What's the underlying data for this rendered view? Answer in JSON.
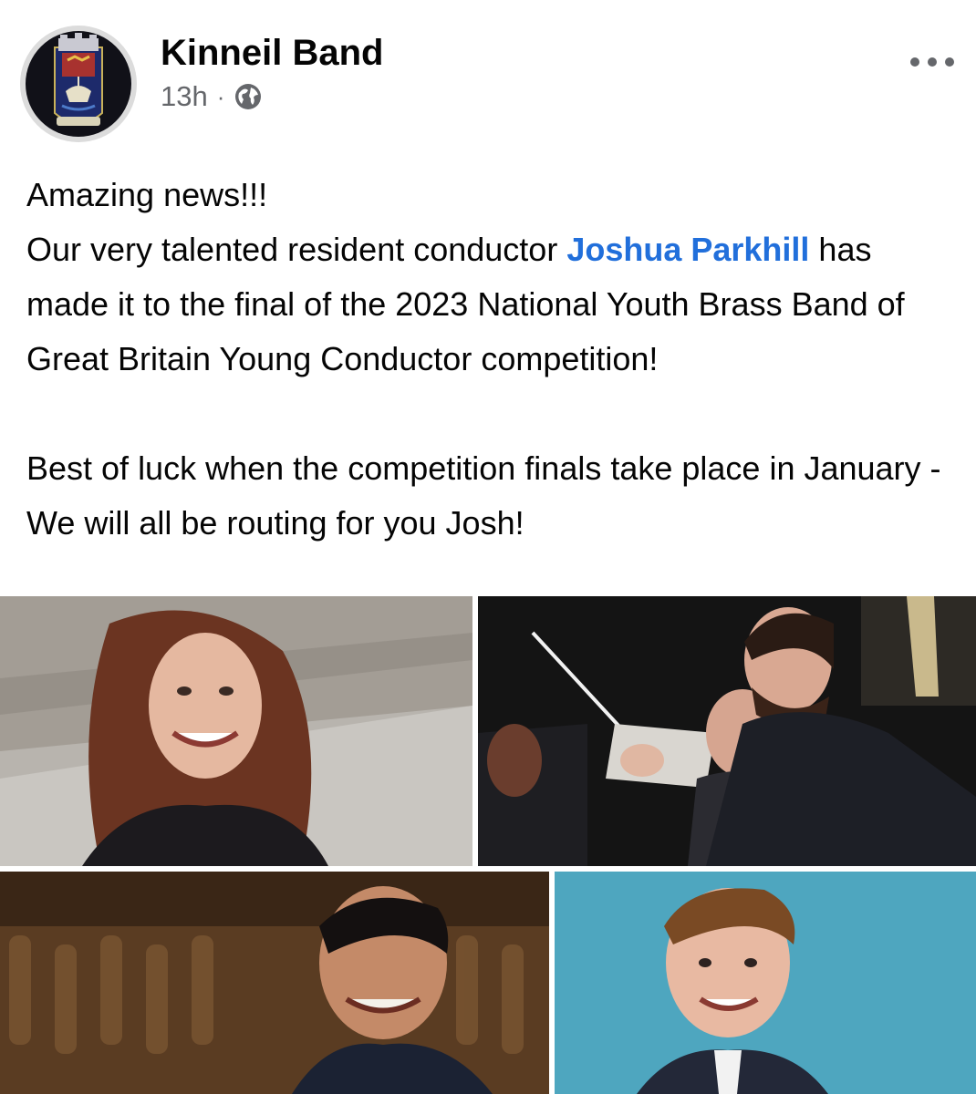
{
  "post": {
    "page_name": "Kinneil Band",
    "time": "13h",
    "separator": "·",
    "audience_icon": "globe-icon",
    "menu_icon": "more-options-icon"
  },
  "body": {
    "line1": "Amazing news!!!",
    "line2_before": "Our very talented resident conductor ",
    "mention": "Joshua Parkhill",
    "line2_after": " has made it to the final of the 2023 National Youth Brass Band of Great Britain Young Conductor competition!",
    "line3": "Best of luck when the competition finals take place in January - We will all be routing for you Josh!"
  },
  "photos": {
    "count": 4,
    "items": [
      "woman-portrait",
      "conductor-with-baton",
      "smiling-man-portrait",
      "man-blue-background"
    ]
  },
  "colors": {
    "mention": "#216fdb",
    "meta": "#65676b",
    "text": "#050505"
  }
}
